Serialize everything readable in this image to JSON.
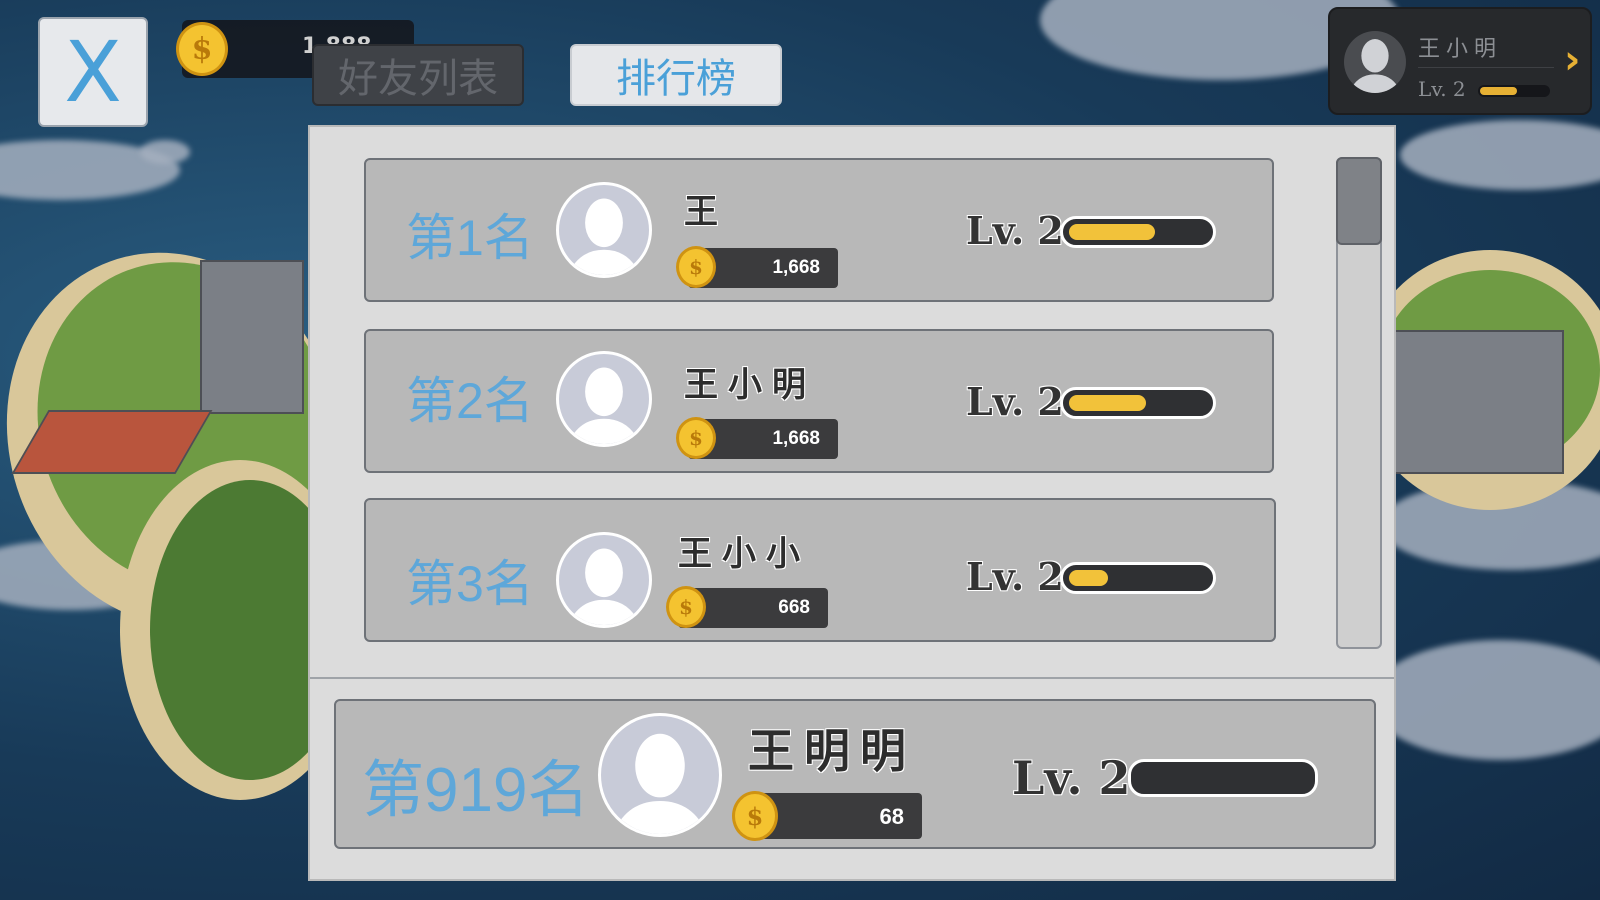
{
  "top_bar": {
    "close_label": "X",
    "coin_balance": "1,888",
    "tabs": [
      {
        "label": "好友列表",
        "active": false
      },
      {
        "label": "排行榜",
        "active": true
      }
    ]
  },
  "profile": {
    "name": "王小明",
    "level": "Lv. 2",
    "xp_fraction": 0.55,
    "arrow": "›"
  },
  "coin_symbol": "$",
  "leaderboard": [
    {
      "rank": "第1名",
      "name": "王",
      "coins": "1,668",
      "level": "Lv. 2",
      "xp_fraction": 0.62
    },
    {
      "rank": "第2名",
      "name": "王小明",
      "coins": "1,668",
      "level": "Lv. 2",
      "xp_fraction": 0.56
    },
    {
      "rank": "第3名",
      "name": "王小小",
      "coins": "668",
      "level": "Lv. 2",
      "xp_fraction": 0.28
    }
  ],
  "self_entry": {
    "rank": "第919名",
    "name": "王明明",
    "coins": "68",
    "level": "Lv. 2",
    "xp_fraction": 0.0
  },
  "colors": {
    "accent_blue": "#5ea7d9",
    "xp_gold": "#f2c23a",
    "panel": "#dcdcdc",
    "row": "#b8b8b8"
  }
}
